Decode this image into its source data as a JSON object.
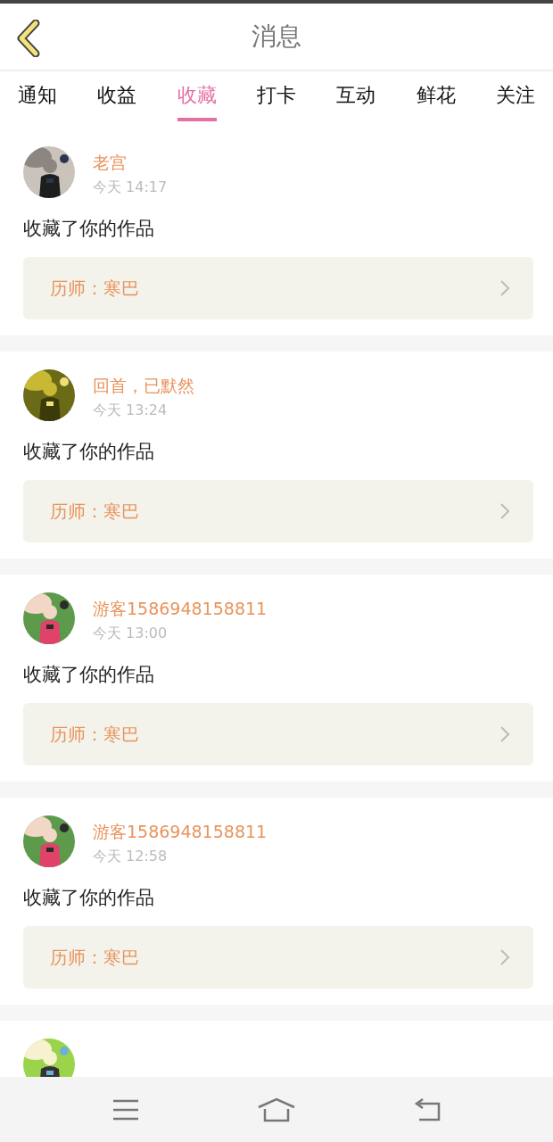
{
  "header": {
    "title": "消息"
  },
  "tabs": [
    {
      "label": "通知",
      "selected": false
    },
    {
      "label": "收益",
      "selected": false
    },
    {
      "label": "收藏",
      "selected": true
    },
    {
      "label": "打卡",
      "selected": false
    },
    {
      "label": "互动",
      "selected": false
    },
    {
      "label": "鲜花",
      "selected": false
    },
    {
      "label": "关注",
      "selected": false
    }
  ],
  "messages": [
    {
      "avatar": {
        "kind": "picture"
      },
      "name": "老宫",
      "time": "今天 14:17",
      "text": "收藏了你的作品",
      "work": "历师：寒巴"
    },
    {
      "avatar": {
        "kind": "picture"
      },
      "name": "回首，已默然",
      "time": "今天 13:24",
      "text": "收藏了你的作品",
      "work": "历师：寒巴"
    },
    {
      "avatar": {
        "kind": "picture"
      },
      "name": "游客1586948158811",
      "time": "今天 13:00",
      "text": "收藏了你的作品",
      "work": "历师：寒巴"
    },
    {
      "avatar": {
        "kind": "picture"
      },
      "name": "游客1586948158811",
      "time": "今天 12:58",
      "text": "收藏了你的作品",
      "work": "历师：寒巴"
    },
    {
      "avatar": {
        "kind": "picture"
      }
    }
  ]
}
